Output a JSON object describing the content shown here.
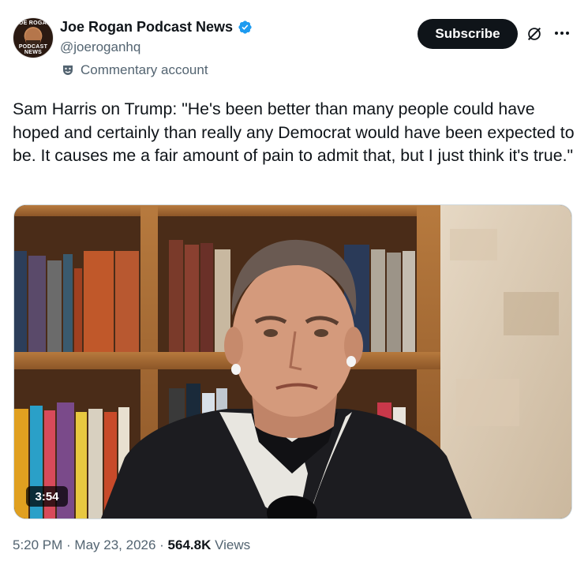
{
  "author": {
    "display_name": "Joe Rogan Podcast News",
    "handle": "@joeroganhq",
    "label": "Commentary account",
    "avatar_text_top": "JOE ROGAN",
    "avatar_text_bottom": "PODCAST NEWS",
    "verified": true
  },
  "actions": {
    "subscribe_label": "Subscribe"
  },
  "post": {
    "text": "Sam Harris on Trump: \"He's been better than many people could have hoped and certainly than really any Democrat would have been expected to be. It causes me a fair amount of pain to admit that, but I just think it's true.\""
  },
  "video": {
    "duration": "3:54"
  },
  "meta": {
    "time": "5:20 PM",
    "date": "May 23, 2026",
    "separator": " · ",
    "views_count": "564.8K",
    "views_label": " Views"
  },
  "colors": {
    "verified_blue": "#1d9bf0",
    "text_primary": "#0f1419",
    "text_secondary": "#536471",
    "subscribe_bg": "#0f1419"
  },
  "icons": [
    "verified-badge-icon",
    "theater-mask-icon",
    "grok-icon",
    "more-icon"
  ]
}
